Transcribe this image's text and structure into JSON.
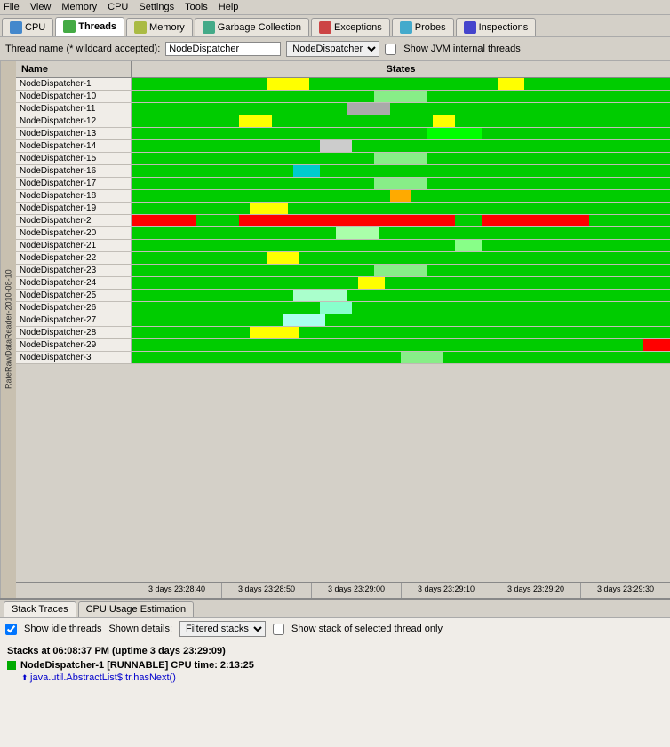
{
  "menubar": {
    "items": [
      "File",
      "View",
      "Memory",
      "CPU",
      "Settings",
      "Tools",
      "Help"
    ]
  },
  "tabs": [
    {
      "id": "cpu",
      "label": "CPU",
      "icon_color": "#4488cc",
      "active": false
    },
    {
      "id": "threads",
      "label": "Threads",
      "icon_color": "#44aa44",
      "active": true
    },
    {
      "id": "memory",
      "label": "Memory",
      "icon_color": "#aabb44",
      "active": false
    },
    {
      "id": "gc",
      "label": "Garbage Collection",
      "icon_color": "#44aa88",
      "active": false
    },
    {
      "id": "exceptions",
      "label": "Exceptions",
      "icon_color": "#cc4444",
      "active": false
    },
    {
      "id": "probes",
      "label": "Probes",
      "icon_color": "#44aacc",
      "active": false
    },
    {
      "id": "inspections",
      "label": "Inspections",
      "icon_color": "#4444cc",
      "active": false
    }
  ],
  "filterbar": {
    "label": "Thread name (* wildcard accepted):",
    "value": "NodeDispatcher",
    "checkbox_label": "Show JVM internal threads"
  },
  "table": {
    "col_name": "Name",
    "col_states": "States",
    "threads": [
      {
        "name": "NodeDispatcher-1",
        "pattern": "mostly_green_with_yellow"
      },
      {
        "name": "NodeDispatcher-10",
        "pattern": "mostly_green"
      },
      {
        "name": "NodeDispatcher-11",
        "pattern": "green_with_gray"
      },
      {
        "name": "NodeDispatcher-12",
        "pattern": "green_with_yellow"
      },
      {
        "name": "NodeDispatcher-13",
        "pattern": "mostly_green_2"
      },
      {
        "name": "NodeDispatcher-14",
        "pattern": "green_with_gray_2"
      },
      {
        "name": "NodeDispatcher-15",
        "pattern": "mostly_green"
      },
      {
        "name": "NodeDispatcher-16",
        "pattern": "green_with_cyan"
      },
      {
        "name": "NodeDispatcher-17",
        "pattern": "mostly_green"
      },
      {
        "name": "NodeDispatcher-18",
        "pattern": "green_with_orange"
      },
      {
        "name": "NodeDispatcher-19",
        "pattern": "green_with_yellow_2"
      },
      {
        "name": "NodeDispatcher-2",
        "pattern": "red_dominant"
      },
      {
        "name": "NodeDispatcher-20",
        "pattern": "green_with_cyan_2"
      },
      {
        "name": "NodeDispatcher-21",
        "pattern": "mostly_green_3"
      },
      {
        "name": "NodeDispatcher-22",
        "pattern": "green_with_yellow_3"
      },
      {
        "name": "NodeDispatcher-23",
        "pattern": "mostly_green"
      },
      {
        "name": "NodeDispatcher-24",
        "pattern": "green_with_yellow_4"
      },
      {
        "name": "NodeDispatcher-25",
        "pattern": "green_with_cyan_3"
      },
      {
        "name": "NodeDispatcher-26",
        "pattern": "green_with_cyan_4"
      },
      {
        "name": "NodeDispatcher-27",
        "pattern": "green_with_cyan_5"
      },
      {
        "name": "NodeDispatcher-28",
        "pattern": "green_with_yellow_5"
      },
      {
        "name": "NodeDispatcher-29",
        "pattern": "green_with_red"
      },
      {
        "name": "NodeDispatcher-3",
        "pattern": "mostly_green_4"
      }
    ]
  },
  "timeline": {
    "ticks": [
      "3 days 23:28:40",
      "3 days 23:28:50",
      "3 days 23:29:00",
      "3 days 23:29:10",
      "3 days 23:29:20",
      "3 days 23:29:30"
    ]
  },
  "sidebar_label": "RateRawDataReader-2010-08-10",
  "bottom_panel": {
    "tabs": [
      "Stack Traces",
      "CPU Usage Estimation"
    ],
    "active_tab": "Stack Traces",
    "show_idle_label": "Show idle threads",
    "show_idle_checked": true,
    "shown_details_label": "Shown details:",
    "shown_details_value": "Filtered stacks",
    "show_stack_label": "Show stack of selected thread only",
    "stacks_title": "Stacks at 06:08:37 PM (uptime 3 days 23:29:09)",
    "thread_entry": {
      "name": "NodeDispatcher-1",
      "state": "RUNNABLE",
      "cpu_time": "CPU time: 2:13:25",
      "frame": "java.util.AbstractList$Itr.hasNext()"
    }
  }
}
